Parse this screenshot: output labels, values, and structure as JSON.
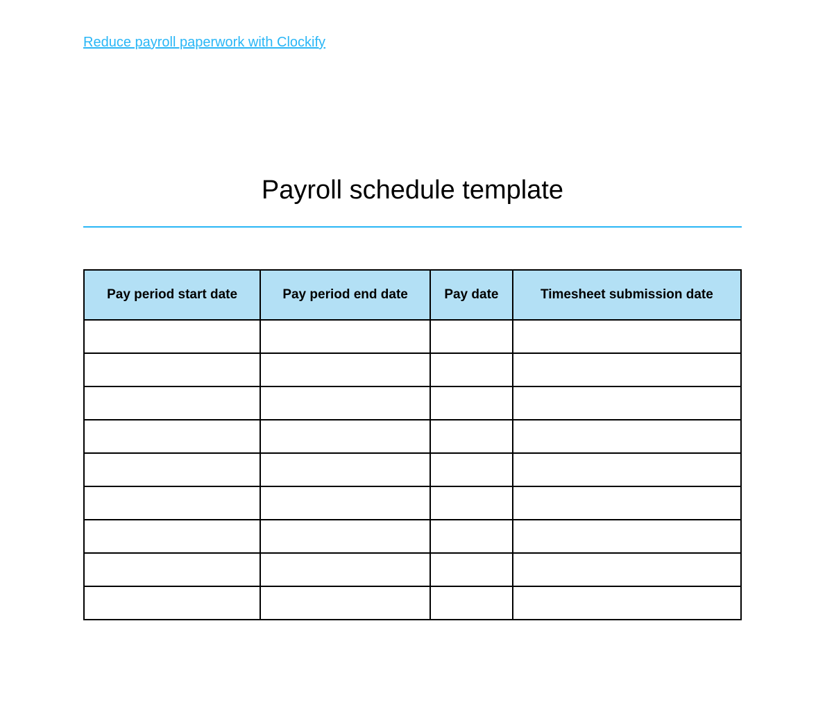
{
  "link": {
    "text": "Reduce payroll paperwork with Clockify"
  },
  "title": "Payroll schedule template",
  "table": {
    "headers": [
      "Pay period start date",
      "Pay period end date",
      "Pay date",
      "Timesheet submission date"
    ],
    "rows": [
      [
        "",
        "",
        "",
        ""
      ],
      [
        "",
        "",
        "",
        ""
      ],
      [
        "",
        "",
        "",
        ""
      ],
      [
        "",
        "",
        "",
        ""
      ],
      [
        "",
        "",
        "",
        ""
      ],
      [
        "",
        "",
        "",
        ""
      ],
      [
        "",
        "",
        "",
        ""
      ],
      [
        "",
        "",
        "",
        ""
      ],
      [
        "",
        "",
        "",
        ""
      ]
    ]
  }
}
